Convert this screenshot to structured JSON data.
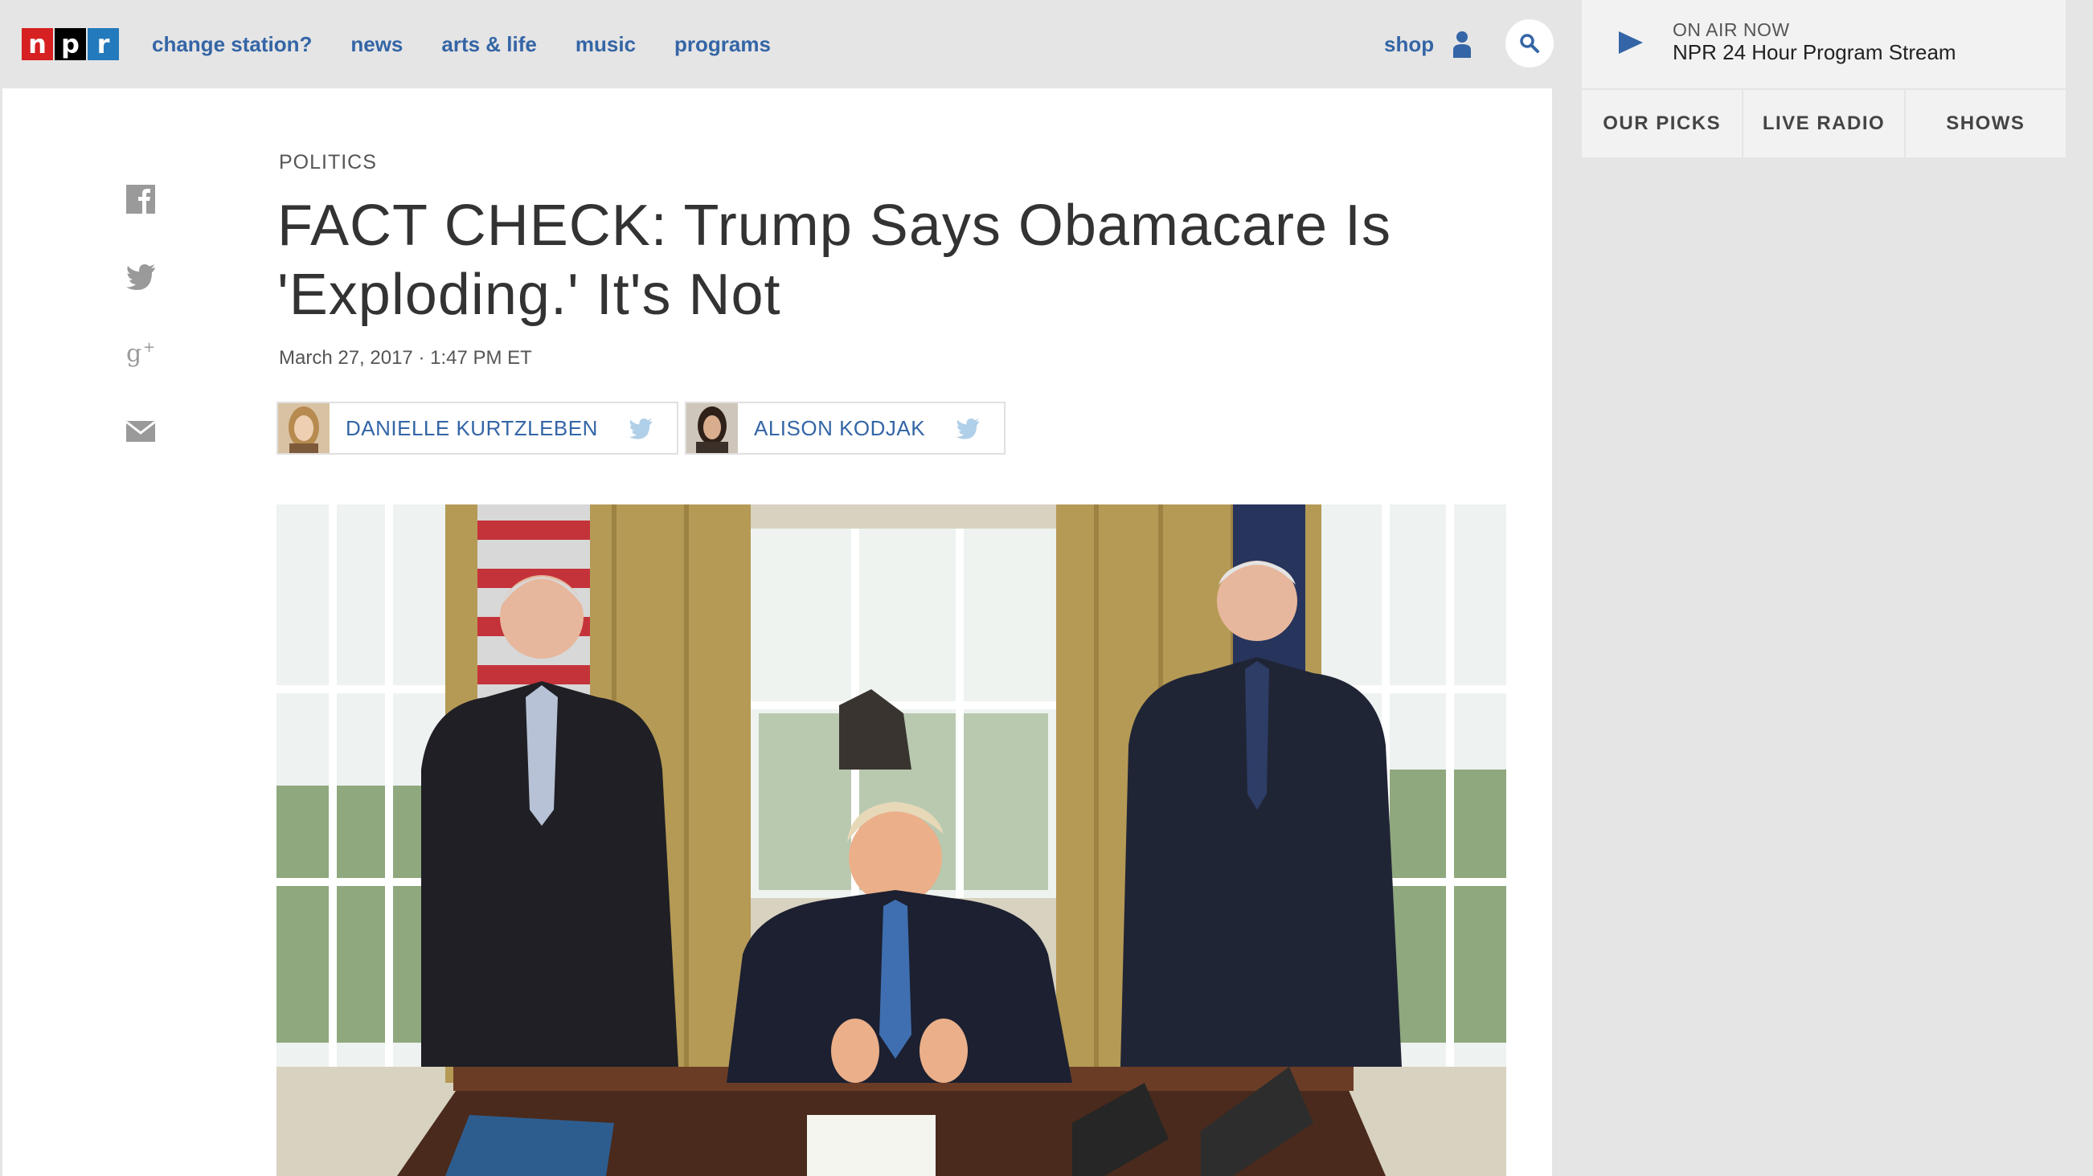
{
  "nav": {
    "logo": [
      "n",
      "p",
      "r"
    ],
    "links": [
      "change station?",
      "news",
      "arts & life",
      "music",
      "programs"
    ],
    "shop": "shop"
  },
  "icons": {
    "user": "user-icon",
    "search": "search-icon",
    "share": [
      "facebook-icon",
      "twitter-icon",
      "google-plus-icon",
      "email-icon"
    ],
    "play": "play-icon"
  },
  "article": {
    "section": "POLITICS",
    "headline": "FACT CHECK: Trump Says Obamacare Is 'Exploding.' It's Not",
    "date": "March 27, 2017 · 1:47 PM ET",
    "bylines": [
      {
        "name": "DANIELLE KURTZLEBEN"
      },
      {
        "name": "ALISON KODJAK"
      }
    ]
  },
  "rail": {
    "onair_label": "ON AIR NOW",
    "stream": "NPR 24 Hour Program Stream",
    "tabs": [
      "OUR PICKS",
      "LIVE RADIO",
      "SHOWS"
    ]
  },
  "colors": {
    "link": "#3465a6",
    "logo_n": "#d62021",
    "logo_p": "#000000",
    "logo_r": "#237bbd"
  }
}
